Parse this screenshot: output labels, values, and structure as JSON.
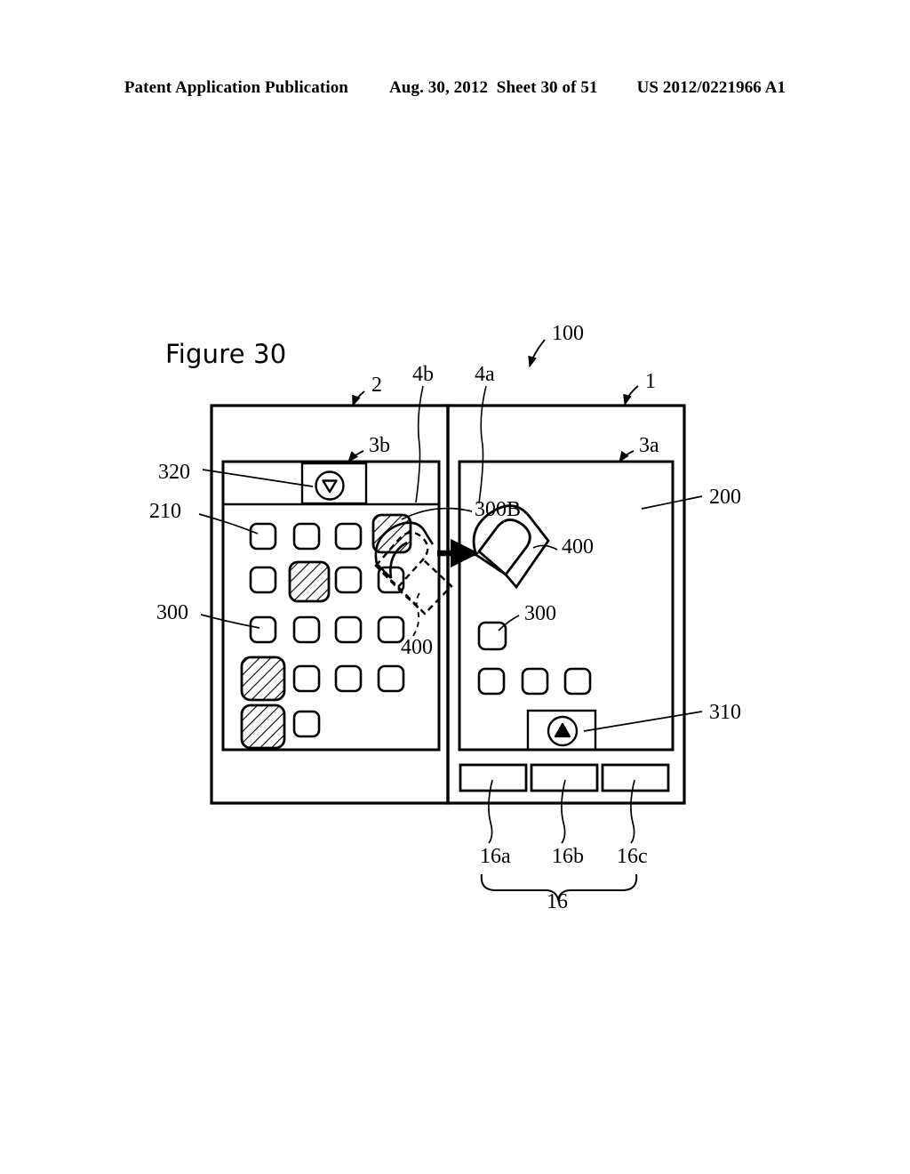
{
  "header": {
    "publication": "Patent Application Publication",
    "date": "Aug. 30, 2012",
    "sheet": "Sheet 30 of 51",
    "number": "US 2012/0221966 A1"
  },
  "figure": {
    "title": "Figure 30",
    "caption_number": "30"
  },
  "reference_labels": {
    "device_assembly": "100",
    "body_right": "1",
    "body_left": "2",
    "screen_right": "3a",
    "screen_left": "3b",
    "bezel_right": "4a",
    "bezel_left": "4b",
    "hw_buttons_group": "16",
    "hw_button_a": "16a",
    "hw_button_b": "16b",
    "hw_button_c": "16c",
    "display_area_right": "200",
    "display_area_left": "210",
    "icon": "300",
    "icon_dragged": "300B",
    "bar_up": "310",
    "bar_down": "320",
    "finger": "400",
    "finger_left": "400"
  },
  "left_screen": {
    "toolbar": {
      "label": "320",
      "icon": "circle-down-triangle"
    },
    "grid": {
      "columns": 4,
      "rows": 5,
      "cells": [
        {
          "row": 1,
          "col": 1,
          "style": "plain",
          "size": "small"
        },
        {
          "row": 1,
          "col": 2,
          "style": "plain",
          "size": "small"
        },
        {
          "row": 1,
          "col": 3,
          "style": "plain",
          "size": "small"
        },
        {
          "row": 1,
          "col": 4,
          "style": "hatched",
          "size": "large"
        },
        {
          "row": 2,
          "col": 1,
          "style": "plain",
          "size": "small"
        },
        {
          "row": 2,
          "col": 2,
          "style": "hatched",
          "size": "large"
        },
        {
          "row": 2,
          "col": 3,
          "style": "plain",
          "size": "small"
        },
        {
          "row": 2,
          "col": 4,
          "style": "plain",
          "size": "small"
        },
        {
          "row": 3,
          "col": 1,
          "style": "plain",
          "size": "small"
        },
        {
          "row": 3,
          "col": 2,
          "style": "plain",
          "size": "small"
        },
        {
          "row": 3,
          "col": 3,
          "style": "plain",
          "size": "small"
        },
        {
          "row": 3,
          "col": 4,
          "style": "plain",
          "size": "small"
        },
        {
          "row": 4,
          "col": 1,
          "style": "hatched",
          "size": "large"
        },
        {
          "row": 4,
          "col": 2,
          "style": "plain",
          "size": "small"
        },
        {
          "row": 4,
          "col": 3,
          "style": "plain",
          "size": "small"
        },
        {
          "row": 4,
          "col": 4,
          "style": "plain",
          "size": "small"
        },
        {
          "row": 5,
          "col": 1,
          "style": "hatched",
          "size": "large"
        },
        {
          "row": 5,
          "col": 2,
          "style": "plain",
          "size": "small"
        }
      ]
    },
    "finger_outline": "dashed-finger-at-row1-col4"
  },
  "right_screen": {
    "finger_solid": "solid-finger-dropped",
    "icons_single_row": 1,
    "icons_bottom_row": 3,
    "toolbar": {
      "label": "310",
      "icon": "circle-up-triangle"
    }
  },
  "hardware_buttons": [
    "16a",
    "16b",
    "16c"
  ],
  "arrow": {
    "direction": "right",
    "meaning": "drag icon from left screen to right screen"
  },
  "colors": {
    "ink": "#000000",
    "paper": "#ffffff"
  }
}
